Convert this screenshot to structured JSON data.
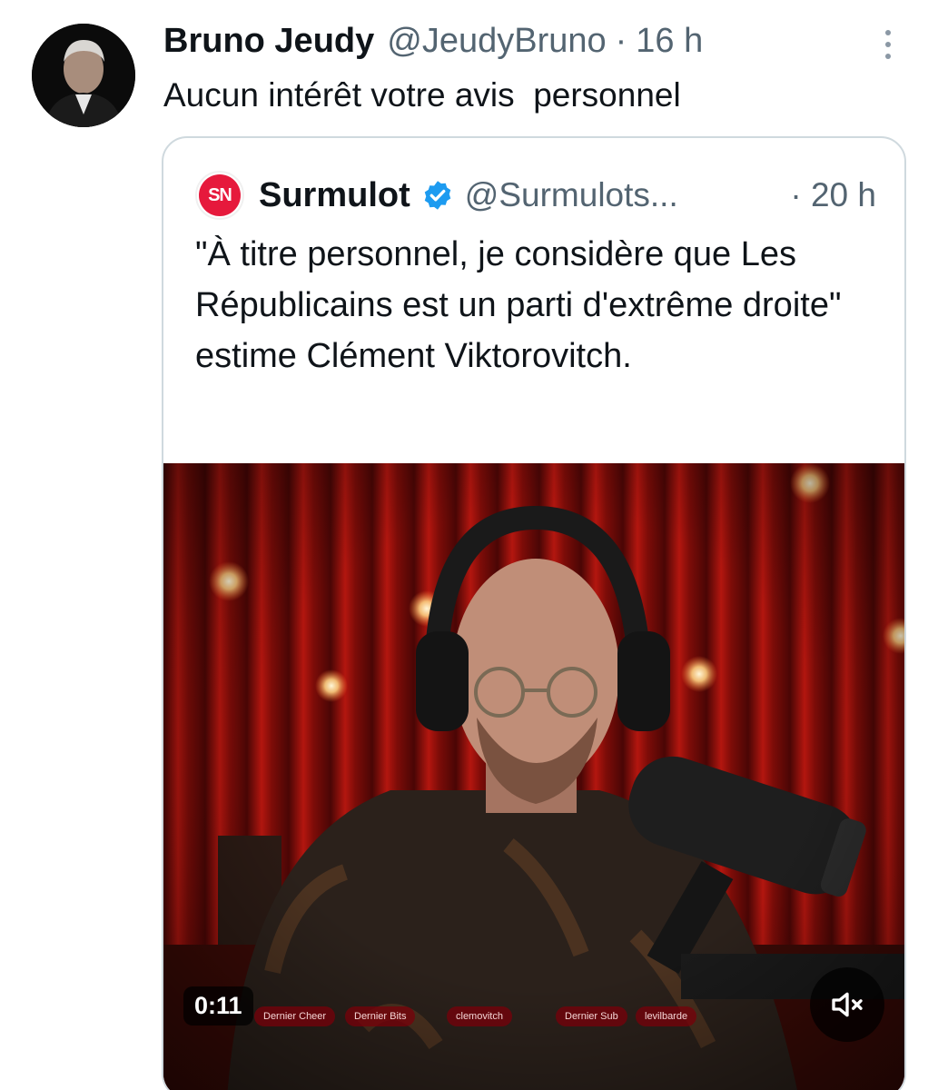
{
  "tweet": {
    "author_name": "Bruno Jeudy",
    "handle": "@JeudyBruno",
    "separator": "·",
    "time": "16 h",
    "text": "Aucun intérêt votre avis  personnel"
  },
  "quoted": {
    "avatar_text": "SN",
    "author_name": "Surmulot",
    "handle": "@Surmulots...",
    "time": "· 20 h",
    "text": "\"À titre personnel, je considère que Les Républicains est un parti d'extrême droite\" estime Clément Viktorovitch.",
    "verified_color": "#1d9bf0"
  },
  "video": {
    "duration": "0:11",
    "overlay_labels": [
      "Dernier Cheer",
      "Dernier Bits",
      "clemovitch",
      "Dernier Sub",
      "levilbarde"
    ]
  },
  "icons": {
    "more": "more-vertical-icon",
    "mute": "volume-muted-icon",
    "verified": "verified-badge-icon"
  }
}
